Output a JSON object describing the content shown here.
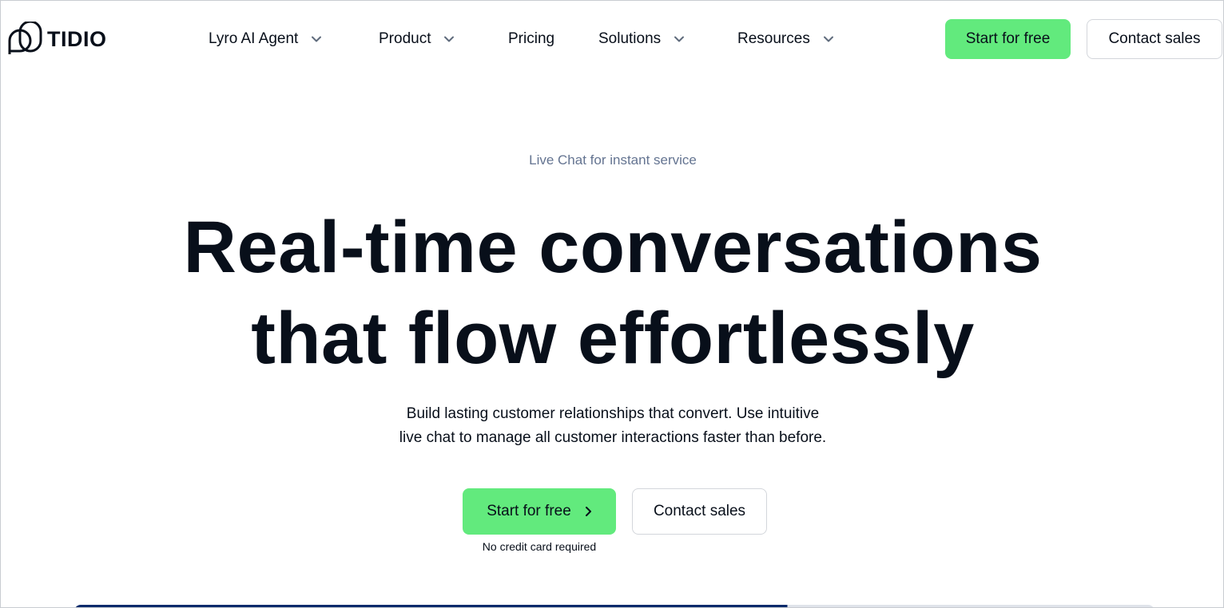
{
  "brand": {
    "name": "TIDIO",
    "logo_icon": "tidio-logo-icon"
  },
  "nav": {
    "items": [
      {
        "label": "Lyro AI Agent",
        "has_dropdown": true
      },
      {
        "label": "Product",
        "has_dropdown": true
      },
      {
        "label": "Pricing",
        "has_dropdown": false
      },
      {
        "label": "Solutions",
        "has_dropdown": true
      },
      {
        "label": "Resources",
        "has_dropdown": true
      }
    ],
    "start_free_label": "Start for free",
    "contact_sales_label": "Contact sales"
  },
  "hero": {
    "eyebrow": "Live Chat for instant service",
    "headline_line1": "Real-time conversations",
    "headline_line2": "that flow effortlessly",
    "subtitle_line1": "Build lasting customer relationships that convert. Use intuitive",
    "subtitle_line2": "live chat to manage all customer interactions faster than before.",
    "cta_primary": "Start for free",
    "cta_secondary": "Contact sales",
    "note": "No credit card required"
  },
  "colors": {
    "accent_green": "#62ea7d",
    "text_dark": "#080f1a",
    "muted": "#647491",
    "border": "#d3d6db"
  }
}
